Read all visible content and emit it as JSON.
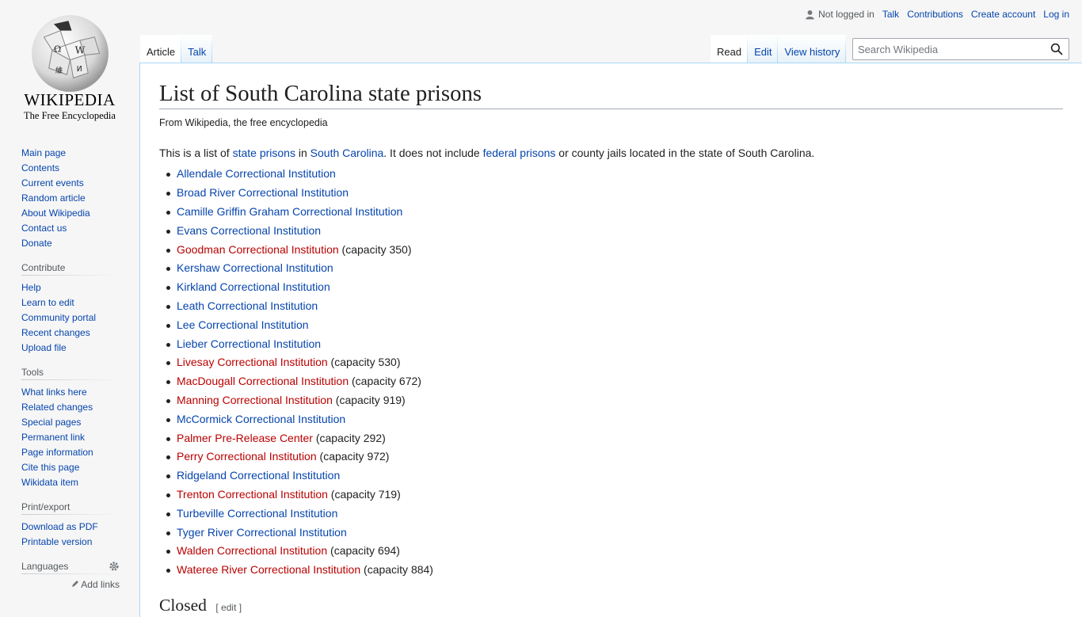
{
  "logo": {
    "wordmark": "WIKIPEDIA",
    "tagline": "The Free Encyclopedia"
  },
  "personal": {
    "not_logged_in": "Not logged in",
    "talk": "Talk",
    "contributions": "Contributions",
    "create_account": "Create account",
    "log_in": "Log in"
  },
  "tabs": {
    "article": "Article",
    "talk": "Talk",
    "read": "Read",
    "edit": "Edit",
    "view_history": "View history"
  },
  "search": {
    "placeholder": "Search Wikipedia"
  },
  "sidebar": {
    "navigation": [
      "Main page",
      "Contents",
      "Current events",
      "Random article",
      "About Wikipedia",
      "Contact us",
      "Donate"
    ],
    "contribute": {
      "heading": "Contribute",
      "items": [
        "Help",
        "Learn to edit",
        "Community portal",
        "Recent changes",
        "Upload file"
      ]
    },
    "tools": {
      "heading": "Tools",
      "items": [
        "What links here",
        "Related changes",
        "Special pages",
        "Permanent link",
        "Page information",
        "Cite this page",
        "Wikidata item"
      ]
    },
    "print": {
      "heading": "Print/export",
      "items": [
        "Download as PDF",
        "Printable version"
      ]
    },
    "languages": {
      "heading": "Languages",
      "add_links": "Add links"
    }
  },
  "article": {
    "title": "List of South Carolina state prisons",
    "from": "From Wikipedia, the free encyclopedia",
    "intro": {
      "t1": "This is a list of ",
      "l1": "state prisons",
      "t2": " in ",
      "l2": "South Carolina",
      "t3": ". It does not include ",
      "l3": "federal prisons",
      "t4": " or county jails located in the state of South Carolina."
    },
    "prisons": [
      {
        "name": "Allendale Correctional Institution",
        "link": "blue",
        "note": ""
      },
      {
        "name": "Broad River Correctional Institution",
        "link": "blue",
        "note": ""
      },
      {
        "name": "Camille Griffin Graham Correctional Institution",
        "link": "blue",
        "note": ""
      },
      {
        "name": "Evans Correctional Institution",
        "link": "blue",
        "note": ""
      },
      {
        "name": "Goodman Correctional Institution",
        "link": "red",
        "note": " (capacity 350)"
      },
      {
        "name": "Kershaw Correctional Institution",
        "link": "blue",
        "note": ""
      },
      {
        "name": "Kirkland Correctional Institution",
        "link": "blue",
        "note": ""
      },
      {
        "name": "Leath Correctional Institution",
        "link": "blue",
        "note": ""
      },
      {
        "name": "Lee Correctional Institution",
        "link": "blue",
        "note": ""
      },
      {
        "name": "Lieber Correctional Institution",
        "link": "blue",
        "note": ""
      },
      {
        "name": "Livesay Correctional Institution",
        "link": "red",
        "note": " (capacity 530)"
      },
      {
        "name": "MacDougall Correctional Institution",
        "link": "red",
        "note": " (capacity 672)"
      },
      {
        "name": "Manning Correctional Institution",
        "link": "red",
        "note": " (capacity 919)"
      },
      {
        "name": "McCormick Correctional Institution",
        "link": "blue",
        "note": ""
      },
      {
        "name": "Palmer Pre-Release Center",
        "link": "red",
        "note": " (capacity 292)"
      },
      {
        "name": "Perry Correctional Institution",
        "link": "red",
        "note": " (capacity 972)"
      },
      {
        "name": "Ridgeland Correctional Institution",
        "link": "blue",
        "note": ""
      },
      {
        "name": "Trenton Correctional Institution",
        "link": "red",
        "note": " (capacity 719)"
      },
      {
        "name": "Turbeville Correctional Institution",
        "link": "blue",
        "note": ""
      },
      {
        "name": "Tyger River Correctional Institution",
        "link": "blue",
        "note": ""
      },
      {
        "name": "Walden Correctional Institution",
        "link": "red",
        "note": " (capacity 694)"
      },
      {
        "name": "Wateree River Correctional Institution",
        "link": "red",
        "note": " (capacity 884)"
      }
    ],
    "section2": {
      "heading": "Closed",
      "edit": "[ edit ]"
    }
  },
  "colors": {
    "link": "#0645ad",
    "redlink": "#ba0000",
    "text": "#202122"
  }
}
